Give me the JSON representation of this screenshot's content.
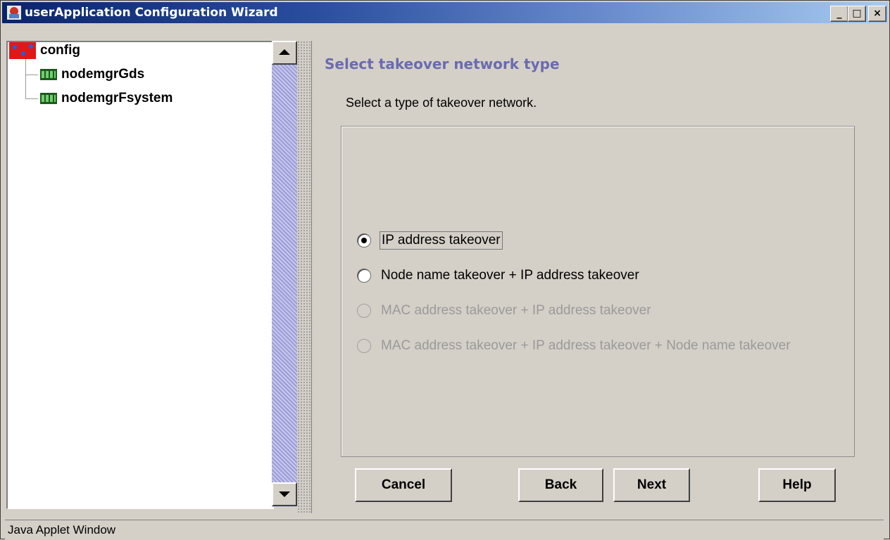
{
  "window": {
    "title": "userApplication Configuration Wizard",
    "controls": {
      "minimize": "_",
      "maximize": "□",
      "close": "×"
    }
  },
  "tree": {
    "root": {
      "label": "config",
      "icon": "config-icon"
    },
    "children": [
      {
        "label": "nodemgrGds",
        "icon": "node-icon"
      },
      {
        "label": "nodemgrFsystem",
        "icon": "node-icon"
      }
    ]
  },
  "panel": {
    "heading": "Select takeover network type",
    "instruction": "Select a type of takeover network.",
    "options": [
      {
        "label": "IP address takeover",
        "selected": true,
        "enabled": true
      },
      {
        "label": "Node name takeover + IP address takeover",
        "selected": false,
        "enabled": true
      },
      {
        "label": "MAC address takeover + IP address takeover",
        "selected": false,
        "enabled": false
      },
      {
        "label": "MAC address takeover + IP address takeover + Node name takeover",
        "selected": false,
        "enabled": false
      }
    ]
  },
  "buttons": {
    "cancel": "Cancel",
    "back": "Back",
    "next": "Next",
    "help": "Help"
  },
  "status": {
    "text": "Java Applet Window"
  },
  "colors": {
    "title_bar_start": "#0a246a",
    "title_bar_end": "#a6caf0",
    "heading": "#6b6bae",
    "window_bg": "#d4d0c8"
  }
}
